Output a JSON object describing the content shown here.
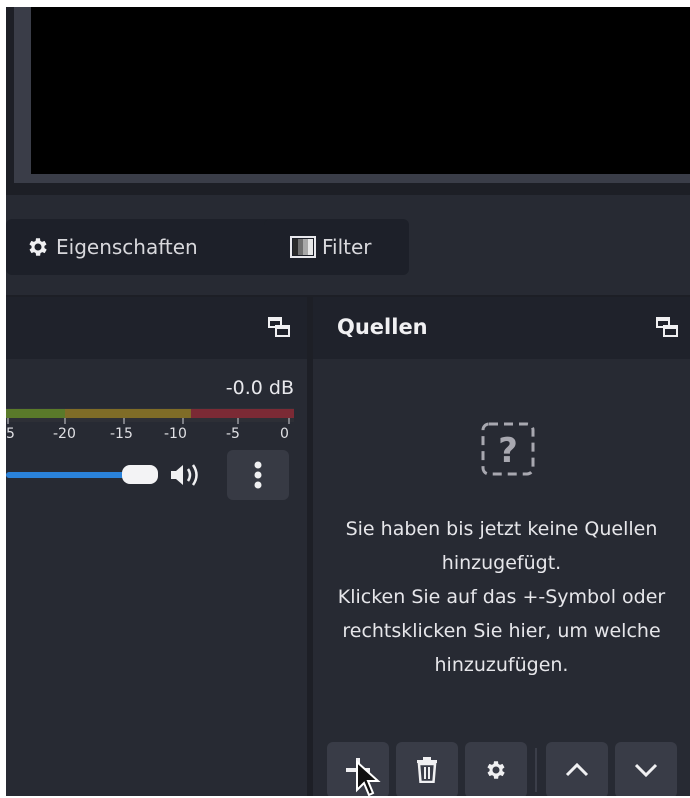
{
  "toolbar": {
    "properties_label": "Eigenschaften",
    "filter_label": "Filter"
  },
  "mixer": {
    "db_value": "-0.0 dB",
    "ticks": [
      "5",
      "-20",
      "-15",
      "-10",
      "-5",
      "0"
    ],
    "volume_level": 0.95
  },
  "sources": {
    "title": "Quellen",
    "empty_lines": [
      "Sie haben bis jetzt keine Quellen",
      "hinzugefügt.",
      "Klicken Sie auf das +-Symbol oder",
      "rechtsklicken Sie hier, um welche",
      "hinzuzufügen."
    ]
  },
  "icons": {
    "properties": "gear-icon",
    "filter": "filter-icon",
    "dock_float": "undock-icon",
    "speaker": "speaker-icon",
    "menu": "vertical-dots-icon",
    "empty": "question-icon",
    "add": "plus-icon",
    "remove": "trash-icon",
    "config": "gear-icon",
    "up": "chevron-up-icon",
    "down": "chevron-down-icon"
  },
  "colors": {
    "accent": "#2a82da",
    "background": "#1d1f26",
    "panel": "#272a33"
  }
}
